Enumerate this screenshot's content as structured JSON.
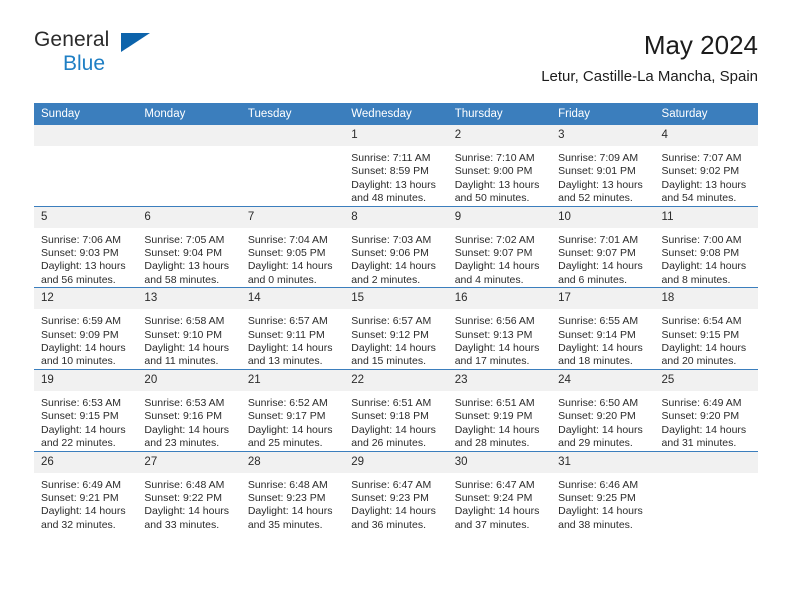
{
  "brand": {
    "name_part1": "General",
    "name_part2": "Blue",
    "mark": "triangle-logo"
  },
  "header": {
    "title": "May 2024",
    "subtitle": "Letur, Castille-La Mancha, Spain"
  },
  "colors": {
    "header_blue": "#3b7ebd",
    "brand_blue": "#1f7fc4",
    "mark_blue": "#0c63ab",
    "daynum_band": "#f1f1f1",
    "text": "#2b2b2b"
  },
  "weekdays": [
    "Sunday",
    "Monday",
    "Tuesday",
    "Wednesday",
    "Thursday",
    "Friday",
    "Saturday"
  ],
  "weeks": [
    [
      {
        "day": "",
        "sunrise": "",
        "sunset": "",
        "daylight1": "",
        "daylight2": ""
      },
      {
        "day": "",
        "sunrise": "",
        "sunset": "",
        "daylight1": "",
        "daylight2": ""
      },
      {
        "day": "",
        "sunrise": "",
        "sunset": "",
        "daylight1": "",
        "daylight2": ""
      },
      {
        "day": "1",
        "sunrise": "Sunrise: 7:11 AM",
        "sunset": "Sunset: 8:59 PM",
        "daylight1": "Daylight: 13 hours",
        "daylight2": "and 48 minutes."
      },
      {
        "day": "2",
        "sunrise": "Sunrise: 7:10 AM",
        "sunset": "Sunset: 9:00 PM",
        "daylight1": "Daylight: 13 hours",
        "daylight2": "and 50 minutes."
      },
      {
        "day": "3",
        "sunrise": "Sunrise: 7:09 AM",
        "sunset": "Sunset: 9:01 PM",
        "daylight1": "Daylight: 13 hours",
        "daylight2": "and 52 minutes."
      },
      {
        "day": "4",
        "sunrise": "Sunrise: 7:07 AM",
        "sunset": "Sunset: 9:02 PM",
        "daylight1": "Daylight: 13 hours",
        "daylight2": "and 54 minutes."
      }
    ],
    [
      {
        "day": "5",
        "sunrise": "Sunrise: 7:06 AM",
        "sunset": "Sunset: 9:03 PM",
        "daylight1": "Daylight: 13 hours",
        "daylight2": "and 56 minutes."
      },
      {
        "day": "6",
        "sunrise": "Sunrise: 7:05 AM",
        "sunset": "Sunset: 9:04 PM",
        "daylight1": "Daylight: 13 hours",
        "daylight2": "and 58 minutes."
      },
      {
        "day": "7",
        "sunrise": "Sunrise: 7:04 AM",
        "sunset": "Sunset: 9:05 PM",
        "daylight1": "Daylight: 14 hours",
        "daylight2": "and 0 minutes."
      },
      {
        "day": "8",
        "sunrise": "Sunrise: 7:03 AM",
        "sunset": "Sunset: 9:06 PM",
        "daylight1": "Daylight: 14 hours",
        "daylight2": "and 2 minutes."
      },
      {
        "day": "9",
        "sunrise": "Sunrise: 7:02 AM",
        "sunset": "Sunset: 9:07 PM",
        "daylight1": "Daylight: 14 hours",
        "daylight2": "and 4 minutes."
      },
      {
        "day": "10",
        "sunrise": "Sunrise: 7:01 AM",
        "sunset": "Sunset: 9:07 PM",
        "daylight1": "Daylight: 14 hours",
        "daylight2": "and 6 minutes."
      },
      {
        "day": "11",
        "sunrise": "Sunrise: 7:00 AM",
        "sunset": "Sunset: 9:08 PM",
        "daylight1": "Daylight: 14 hours",
        "daylight2": "and 8 minutes."
      }
    ],
    [
      {
        "day": "12",
        "sunrise": "Sunrise: 6:59 AM",
        "sunset": "Sunset: 9:09 PM",
        "daylight1": "Daylight: 14 hours",
        "daylight2": "and 10 minutes."
      },
      {
        "day": "13",
        "sunrise": "Sunrise: 6:58 AM",
        "sunset": "Sunset: 9:10 PM",
        "daylight1": "Daylight: 14 hours",
        "daylight2": "and 11 minutes."
      },
      {
        "day": "14",
        "sunrise": "Sunrise: 6:57 AM",
        "sunset": "Sunset: 9:11 PM",
        "daylight1": "Daylight: 14 hours",
        "daylight2": "and 13 minutes."
      },
      {
        "day": "15",
        "sunrise": "Sunrise: 6:57 AM",
        "sunset": "Sunset: 9:12 PM",
        "daylight1": "Daylight: 14 hours",
        "daylight2": "and 15 minutes."
      },
      {
        "day": "16",
        "sunrise": "Sunrise: 6:56 AM",
        "sunset": "Sunset: 9:13 PM",
        "daylight1": "Daylight: 14 hours",
        "daylight2": "and 17 minutes."
      },
      {
        "day": "17",
        "sunrise": "Sunrise: 6:55 AM",
        "sunset": "Sunset: 9:14 PM",
        "daylight1": "Daylight: 14 hours",
        "daylight2": "and 18 minutes."
      },
      {
        "day": "18",
        "sunrise": "Sunrise: 6:54 AM",
        "sunset": "Sunset: 9:15 PM",
        "daylight1": "Daylight: 14 hours",
        "daylight2": "and 20 minutes."
      }
    ],
    [
      {
        "day": "19",
        "sunrise": "Sunrise: 6:53 AM",
        "sunset": "Sunset: 9:15 PM",
        "daylight1": "Daylight: 14 hours",
        "daylight2": "and 22 minutes."
      },
      {
        "day": "20",
        "sunrise": "Sunrise: 6:53 AM",
        "sunset": "Sunset: 9:16 PM",
        "daylight1": "Daylight: 14 hours",
        "daylight2": "and 23 minutes."
      },
      {
        "day": "21",
        "sunrise": "Sunrise: 6:52 AM",
        "sunset": "Sunset: 9:17 PM",
        "daylight1": "Daylight: 14 hours",
        "daylight2": "and 25 minutes."
      },
      {
        "day": "22",
        "sunrise": "Sunrise: 6:51 AM",
        "sunset": "Sunset: 9:18 PM",
        "daylight1": "Daylight: 14 hours",
        "daylight2": "and 26 minutes."
      },
      {
        "day": "23",
        "sunrise": "Sunrise: 6:51 AM",
        "sunset": "Sunset: 9:19 PM",
        "daylight1": "Daylight: 14 hours",
        "daylight2": "and 28 minutes."
      },
      {
        "day": "24",
        "sunrise": "Sunrise: 6:50 AM",
        "sunset": "Sunset: 9:20 PM",
        "daylight1": "Daylight: 14 hours",
        "daylight2": "and 29 minutes."
      },
      {
        "day": "25",
        "sunrise": "Sunrise: 6:49 AM",
        "sunset": "Sunset: 9:20 PM",
        "daylight1": "Daylight: 14 hours",
        "daylight2": "and 31 minutes."
      }
    ],
    [
      {
        "day": "26",
        "sunrise": "Sunrise: 6:49 AM",
        "sunset": "Sunset: 9:21 PM",
        "daylight1": "Daylight: 14 hours",
        "daylight2": "and 32 minutes."
      },
      {
        "day": "27",
        "sunrise": "Sunrise: 6:48 AM",
        "sunset": "Sunset: 9:22 PM",
        "daylight1": "Daylight: 14 hours",
        "daylight2": "and 33 minutes."
      },
      {
        "day": "28",
        "sunrise": "Sunrise: 6:48 AM",
        "sunset": "Sunset: 9:23 PM",
        "daylight1": "Daylight: 14 hours",
        "daylight2": "and 35 minutes."
      },
      {
        "day": "29",
        "sunrise": "Sunrise: 6:47 AM",
        "sunset": "Sunset: 9:23 PM",
        "daylight1": "Daylight: 14 hours",
        "daylight2": "and 36 minutes."
      },
      {
        "day": "30",
        "sunrise": "Sunrise: 6:47 AM",
        "sunset": "Sunset: 9:24 PM",
        "daylight1": "Daylight: 14 hours",
        "daylight2": "and 37 minutes."
      },
      {
        "day": "31",
        "sunrise": "Sunrise: 6:46 AM",
        "sunset": "Sunset: 9:25 PM",
        "daylight1": "Daylight: 14 hours",
        "daylight2": "and 38 minutes."
      },
      {
        "day": "",
        "sunrise": "",
        "sunset": "",
        "daylight1": "",
        "daylight2": ""
      }
    ]
  ]
}
